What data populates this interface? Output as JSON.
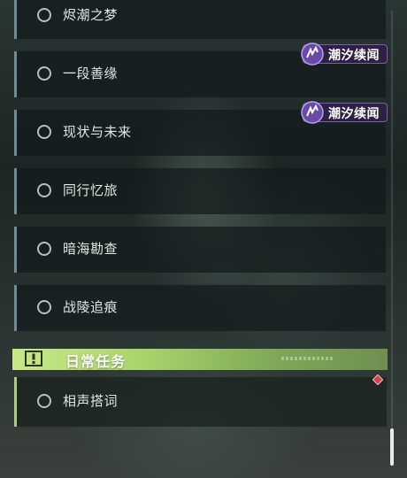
{
  "quests": [
    {
      "title": "烬潮之梦",
      "status": "incomplete"
    },
    {
      "title": "一段善缘",
      "status": "incomplete",
      "tag": "潮汐续闻"
    },
    {
      "title": "现状与未来",
      "status": "incomplete",
      "tag": "潮汐续闻"
    },
    {
      "title": "同行忆旅",
      "status": "incomplete"
    },
    {
      "title": "暗海勘查",
      "status": "incomplete"
    },
    {
      "title": "战陵追痕",
      "status": "incomplete"
    }
  ],
  "section": {
    "title": "日常任务",
    "icon": "alert-icon",
    "accent": "#b8e07a"
  },
  "daily_quest": {
    "title": "相声搭词",
    "status": "incomplete",
    "marker_icon": "red-diamond-icon"
  },
  "colors": {
    "badge_bg": "#2c2140",
    "badge_border": "#7a5fb0",
    "quest_border": "#6f8b96",
    "marker": "#d9434d"
  }
}
